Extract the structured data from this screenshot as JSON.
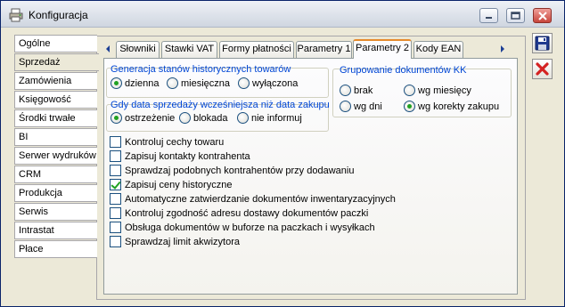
{
  "window": {
    "title": "Konfiguracja",
    "icons": {
      "app": "printer-app-icon",
      "minimize": "minimize-icon",
      "maximize": "maximize-icon",
      "close": "close-icon"
    }
  },
  "categories": [
    {
      "label": "Ogólne",
      "active": false
    },
    {
      "label": "Sprzedaż",
      "active": true
    },
    {
      "label": "Zamówienia",
      "active": false
    },
    {
      "label": "Księgowość",
      "active": false
    },
    {
      "label": "Środki trwałe",
      "active": false
    },
    {
      "label": "BI",
      "active": false
    },
    {
      "label": "Serwer wydruków",
      "active": false
    },
    {
      "label": "CRM",
      "active": false
    },
    {
      "label": "Produkcja",
      "active": false
    },
    {
      "label": "Serwis",
      "active": false
    },
    {
      "label": "Intrastat",
      "active": false
    },
    {
      "label": "Płace",
      "active": false
    }
  ],
  "tabs": [
    {
      "label": "Słowniki",
      "active": false
    },
    {
      "label": "Stawki VAT",
      "active": false
    },
    {
      "label": "Formy płatności",
      "active": false
    },
    {
      "label": "Parametry 1",
      "active": false
    },
    {
      "label": "Parametry 2",
      "active": true
    },
    {
      "label": "Kody EAN",
      "active": false
    }
  ],
  "groups": {
    "historical": {
      "title": "Generacja stanów historycznych towarów",
      "options": [
        {
          "label": "dzienna",
          "selected": true
        },
        {
          "label": "miesięczna",
          "selected": false
        },
        {
          "label": "wyłączona",
          "selected": false
        }
      ]
    },
    "grouping": {
      "title": "Grupowanie dokumentów KK",
      "options": [
        {
          "label": "brak",
          "selected": false
        },
        {
          "label": "wg miesięcy",
          "selected": false
        },
        {
          "label": "wg dni",
          "selected": false
        },
        {
          "label": "wg korekty zakupu",
          "selected": true
        }
      ]
    },
    "sale_date": {
      "title": "Gdy data sprzedaży wcześniejsza niż data zakupu",
      "options": [
        {
          "label": "ostrzeżenie",
          "selected": true
        },
        {
          "label": "blokada",
          "selected": false
        },
        {
          "label": "nie informuj",
          "selected": false
        }
      ]
    }
  },
  "checkboxes": [
    {
      "label": "Kontroluj cechy towaru",
      "checked": false
    },
    {
      "label": "Zapisuj kontakty kontrahenta",
      "checked": false
    },
    {
      "label": "Sprawdzaj podobnych kontrahentów przy dodawaniu",
      "checked": false
    },
    {
      "label": "Zapisuj ceny historyczne",
      "checked": true
    },
    {
      "label": "Automatyczne zatwierdzanie dokumentów inwentaryzacyjnych",
      "checked": false
    },
    {
      "label": "Kontroluj zgodność adresu dostawy dokumentów paczki",
      "checked": false
    },
    {
      "label": "Obsługa dokumentów w buforze na paczkach i wysyłkach",
      "checked": false
    },
    {
      "label": "Sprawdzaj limit akwizytora",
      "checked": false
    }
  ],
  "actions": {
    "save_icon": "floppy-disk-icon",
    "cancel_icon": "red-x-icon"
  },
  "colors": {
    "group_title": "#0046d5",
    "radio_selected": "#21a121",
    "active_tab_accent": "#e68b2c",
    "cancel_red": "#d42222"
  }
}
